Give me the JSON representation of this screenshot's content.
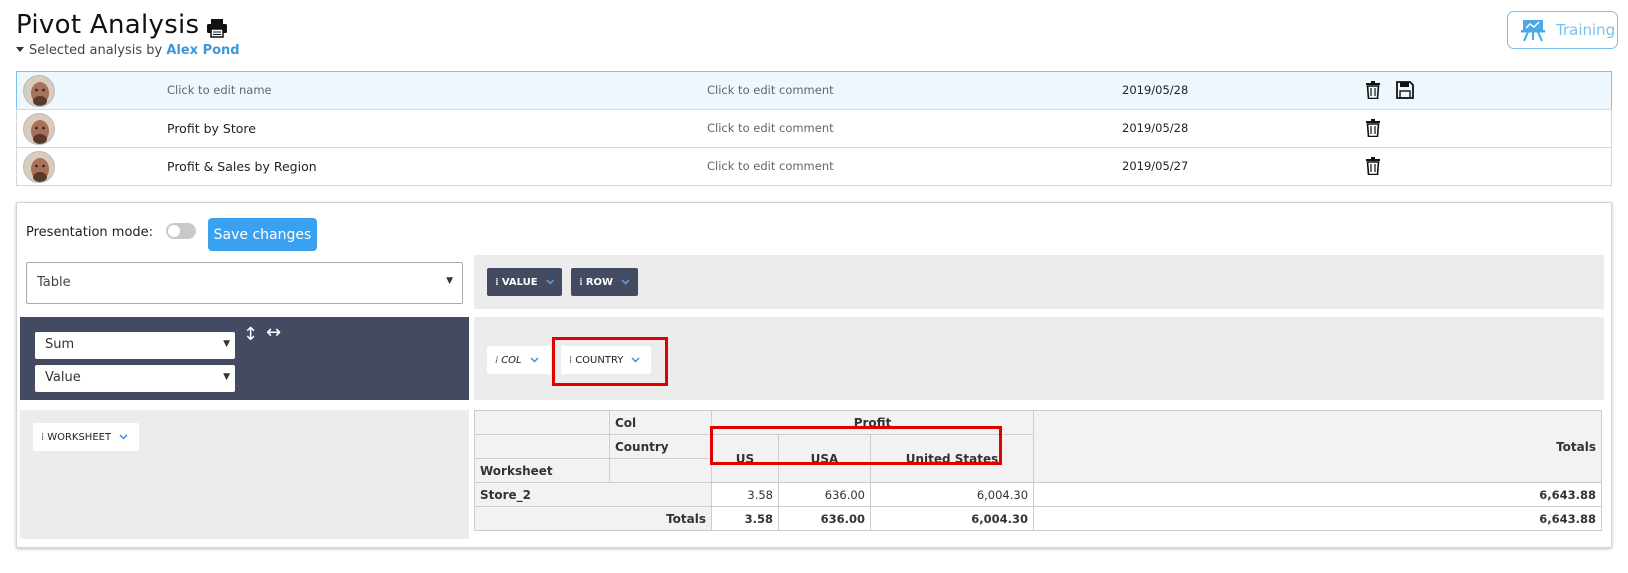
{
  "header": {
    "title": "Pivot Analysis",
    "subtitle_prefix": "Selected analysis by",
    "user": "Alex Pond",
    "training_label": "Training"
  },
  "analyses": [
    {
      "name": "Click to edit name",
      "comment": "Click to edit comment",
      "date": "2019/05/28",
      "selected": true
    },
    {
      "name": "Profit by Store",
      "comment": "Click to edit comment",
      "date": "2019/05/28",
      "selected": false
    },
    {
      "name": "Profit & Sales by Region",
      "comment": "Click to edit comment",
      "date": "2019/05/27",
      "selected": false
    }
  ],
  "controls": {
    "presentation_label": "Presentation mode:",
    "save_label": "Save changes",
    "renderer": "Table",
    "aggregator": "Sum",
    "aggregator_field": "Value",
    "sort_rows_glyph": "↕",
    "sort_cols_glyph": "↔"
  },
  "fields": {
    "cols_area": [
      "VALUE",
      "ROW"
    ],
    "rows_area": [
      "COL",
      "COUNTRY"
    ],
    "unused": [
      "WORKSHEET"
    ]
  },
  "table": {
    "col_attr_1": "Col",
    "col_attr_2": "Country",
    "row_attr": "Worksheet",
    "group_label": "Profit",
    "countries": [
      "US",
      "USA",
      "United States"
    ],
    "totals_label": "Totals",
    "row_label": "Store_2",
    "row_values": [
      "3.58",
      "636.00",
      "6,004.30"
    ],
    "row_total": "6,643.88",
    "total_values": [
      "3.58",
      "636.00",
      "6,004.30"
    ],
    "grand_total": "6,643.88"
  },
  "colors": {
    "accent": "#3aa0f0",
    "link": "#3d97d9",
    "panel_dark": "#454a63",
    "highlight": "#e10000"
  },
  "icons": [
    "print-icon",
    "easel-icon",
    "trash-icon",
    "floppy-icon",
    "chevron-down-icon",
    "grip-icon",
    "sort-vertical-icon",
    "sort-horizontal-icon"
  ]
}
